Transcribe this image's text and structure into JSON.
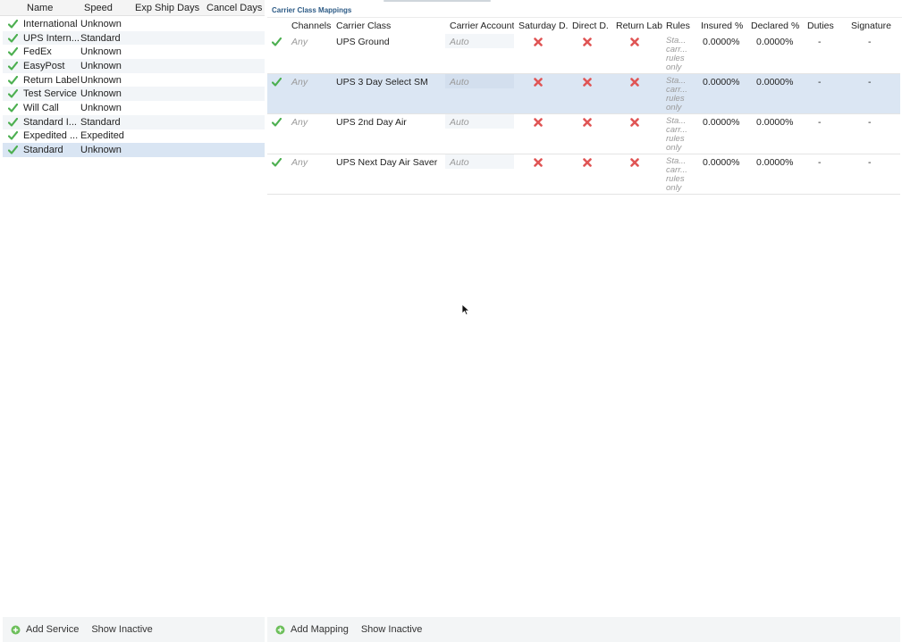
{
  "services": {
    "columns": {
      "name": "Name",
      "speed": "Speed",
      "exp_ship_days": "Exp Ship Days",
      "cancel_days": "Cancel Days"
    },
    "rows": [
      {
        "name": "International",
        "speed": "Unknown"
      },
      {
        "name": "UPS Intern...",
        "speed": "Standard"
      },
      {
        "name": "FedEx",
        "speed": "Unknown"
      },
      {
        "name": "EasyPost",
        "speed": "Unknown"
      },
      {
        "name": "Return Label",
        "speed": "Unknown"
      },
      {
        "name": "Test Service",
        "speed": "Unknown"
      },
      {
        "name": "Will Call",
        "speed": "Unknown"
      },
      {
        "name": "Standard I...",
        "speed": "Standard"
      },
      {
        "name": "Expedited ...",
        "speed": "Expedited"
      },
      {
        "name": "Standard",
        "speed": "Unknown"
      }
    ],
    "selected_index": 9,
    "footer": {
      "add_label": "Add Service",
      "show_inactive_label": "Show Inactive"
    }
  },
  "mappings": {
    "title": "Carrier Class Mappings",
    "columns": {
      "channels": "Channels",
      "carrier_class": "Carrier Class",
      "carrier_account": "Carrier Account",
      "saturday": "Saturday D.",
      "direct": "Direct D.",
      "return_label": "Return Labe",
      "rules": "Rules",
      "insured": "Insured %",
      "declared": "Declared %",
      "duties": "Duties",
      "signature": "Signature"
    },
    "rows": [
      {
        "channels": "Any",
        "carrier_class": "UPS Ground",
        "carrier_account": "Auto",
        "rules": [
          "Sta...",
          "carr...",
          "rules",
          "only"
        ],
        "insured": "0.0000%",
        "declared": "0.0000%",
        "duties": "-",
        "signature": "-"
      },
      {
        "channels": "Any",
        "carrier_class": "UPS 3 Day Select SM",
        "carrier_account": "Auto",
        "rules": [
          "Sta...",
          "carr...",
          "rules",
          "only"
        ],
        "insured": "0.0000%",
        "declared": "0.0000%",
        "duties": "-",
        "signature": "-"
      },
      {
        "channels": "Any",
        "carrier_class": "UPS 2nd Day Air",
        "carrier_account": "Auto",
        "rules": [
          "Sta...",
          "carr...",
          "rules",
          "only"
        ],
        "insured": "0.0000%",
        "declared": "0.0000%",
        "duties": "-",
        "signature": "-"
      },
      {
        "channels": "Any",
        "carrier_class": "UPS Next Day Air Saver",
        "carrier_account": "Auto",
        "rules": [
          "Sta...",
          "carr...",
          "rules",
          "only"
        ],
        "insured": "0.0000%",
        "declared": "0.0000%",
        "duties": "-",
        "signature": "-"
      }
    ],
    "selected_index": 1,
    "footer": {
      "add_label": "Add Mapping",
      "show_inactive_label": "Show Inactive"
    }
  },
  "colors": {
    "check_green": "#4caf50",
    "x_red": "#e05555",
    "title_blue": "#2d5b86",
    "selection": "#d9e5f3"
  },
  "icons": {
    "active": "check-icon",
    "disabled": "x-icon",
    "add": "plus-circle-icon",
    "cursor": "mouse-pointer-icon"
  }
}
